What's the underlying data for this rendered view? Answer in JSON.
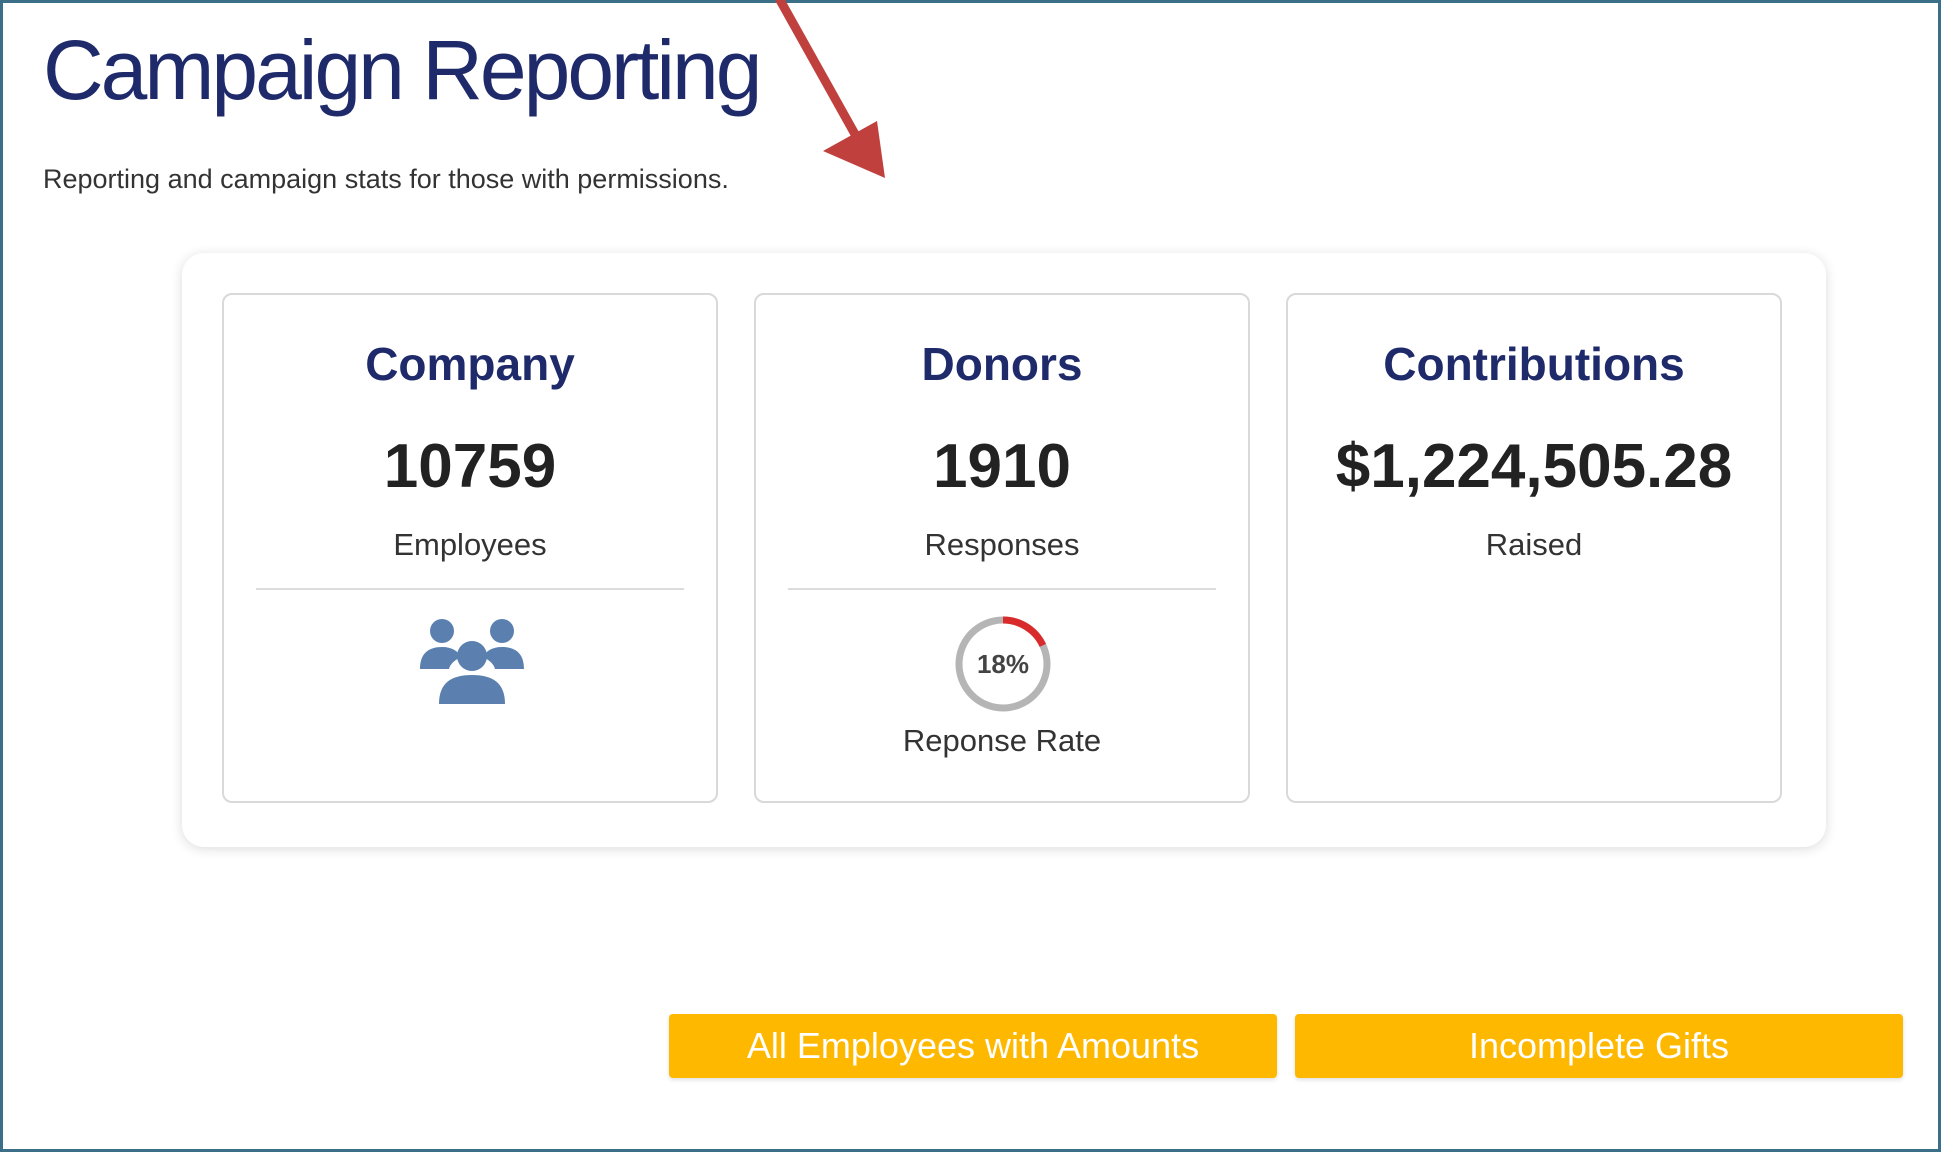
{
  "header": {
    "title": "Campaign Reporting",
    "subtitle": "Reporting and campaign stats for those with permissions."
  },
  "cards": {
    "company": {
      "title": "Company",
      "value": "10759",
      "label": "Employees",
      "icon": "people-group-icon"
    },
    "donors": {
      "title": "Donors",
      "value": "1910",
      "label": "Responses",
      "rate_text": "18%",
      "rate_value": 0.18,
      "rate_label": "Reponse Rate"
    },
    "contributions": {
      "title": "Contributions",
      "value": "$1,224,505.28",
      "label": "Raised"
    }
  },
  "buttons": {
    "all_employees": "All Employees with Amounts",
    "incomplete_gifts": "Incomplete Gifts"
  },
  "colors": {
    "title": "#1f2a6b",
    "accent_button": "#ffb800",
    "icon": "#5b80b0",
    "gauge_track": "#b5b5b5",
    "gauge_fill": "#d92b2b",
    "annotation_arrow": "#c0403e",
    "frame_border": "#3b6f88"
  }
}
